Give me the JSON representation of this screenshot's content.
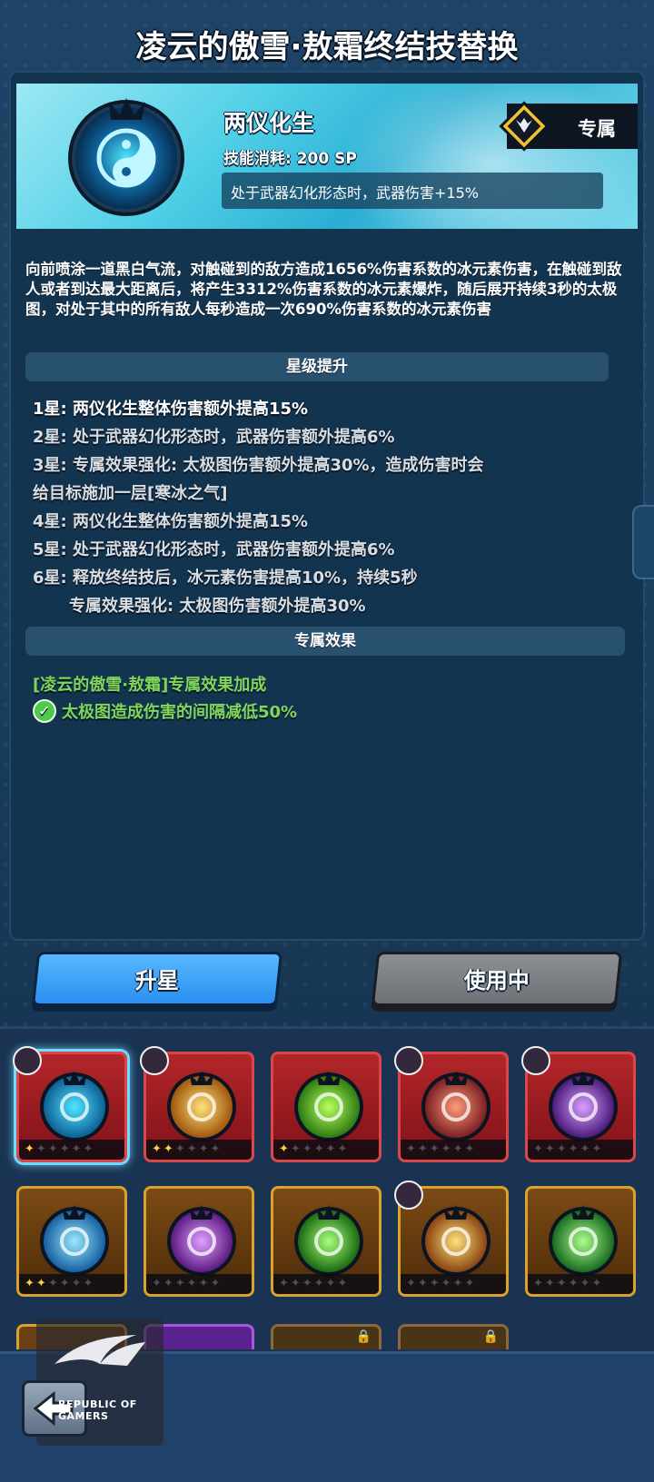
{
  "header": {
    "title": "凌云的傲雪·敖霜终结技替换"
  },
  "skill": {
    "name": "两仪化生",
    "cost": "技能消耗: 200 SP",
    "bonus": "处于武器幻化形态时，武器伤害+15%",
    "exclusive_label": "专属",
    "description": "向前喷涂一道黑白气流，对触碰到的敌方造成1656%伤害系数的冰元素伤害，在触碰到敌人或者到达最大距离后，将产生3312%伤害系数的冰元素爆炸，随后展开持续3秒的太极图，对处于其中的所有敌人每秒造成一次690%伤害系数的冰元素伤害"
  },
  "star_section": {
    "title": "星级提升",
    "lines": [
      "1星: 两仪化生整体伤害额外提高15%",
      "2星: 处于武器幻化形态时，武器伤害额外提高6%",
      "3星: 专属效果强化: 太极图伤害额外提高30%，造成伤害时会",
      "给目标施加一层[寒冰之气]",
      "4星: 两仪化生整体伤害额外提高15%",
      "5星: 处于武器幻化形态时，武器伤害额外提高6%",
      "6星: 释放终结技后，冰元素伤害提高10%，持续5秒",
      "专属效果强化: 太极图伤害额外提高30%"
    ]
  },
  "exclusive_section": {
    "title": "专属效果",
    "effect_title": "[凌云的傲雪·敖霜]专属效果加成",
    "effect_line": "太极图造成伤害的间隔减低50%"
  },
  "buttons": {
    "upgrade": "升星",
    "in_use": "使用中"
  },
  "skill_grid": [
    {
      "icon": "yin-yang-icon",
      "frame": "red",
      "stars": 1,
      "selected": true,
      "hero_badge": true
    },
    {
      "icon": "golden-burst-icon",
      "frame": "red",
      "stars": 2,
      "hero_badge": true
    },
    {
      "icon": "green-swirl-icon",
      "frame": "red",
      "stars": 1
    },
    {
      "icon": "planet-ring-icon",
      "frame": "red",
      "stars": 0,
      "hero_badge": true
    },
    {
      "icon": "purple-arrow-icon",
      "frame": "red",
      "stars": 0,
      "hero_badge": true
    },
    {
      "icon": "ice-shards-icon",
      "frame": "gold",
      "stars": 2
    },
    {
      "icon": "purple-wave-icon",
      "frame": "gold",
      "stars": 0
    },
    {
      "icon": "green-pillars-icon",
      "frame": "gold",
      "stars": 0
    },
    {
      "icon": "lightning-icon",
      "frame": "gold",
      "stars": 0,
      "hero_badge": true
    },
    {
      "icon": "green-up-arrow-icon",
      "frame": "gold",
      "stars": 0
    }
  ],
  "watermark": {
    "line1": "REPUBLIC OF",
    "line2": "GAMERS"
  },
  "colors": {
    "accent_blue": "#2a8ff0",
    "effect_green": "#7fd65a",
    "star_gold": "#ffd23a"
  }
}
